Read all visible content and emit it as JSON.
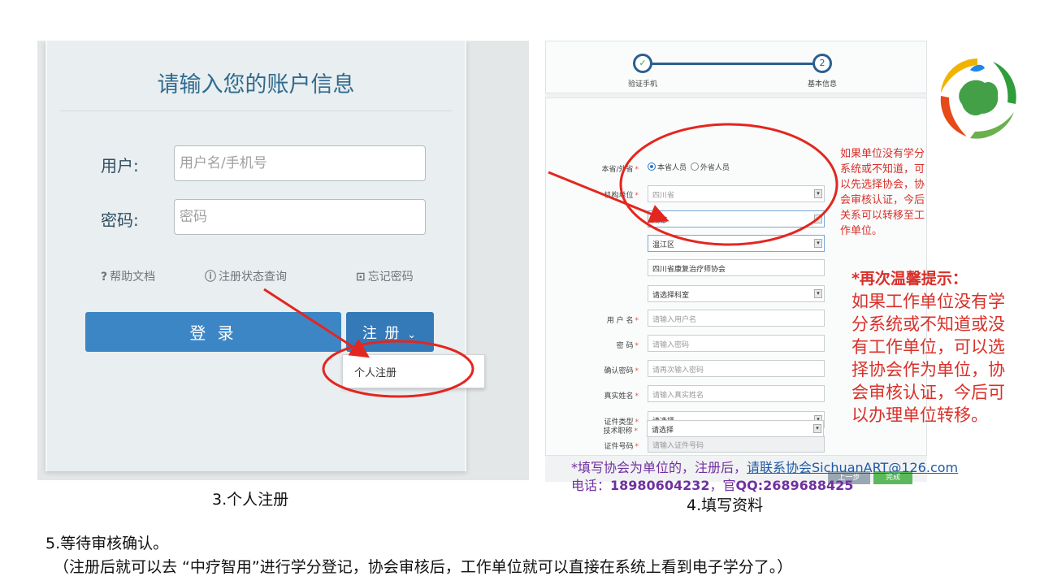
{
  "login": {
    "title": "请输入您的账户信息",
    "user_label": "用户:",
    "user_placeholder": "用户名/手机号",
    "pwd_label": "密码:",
    "pwd_placeholder": "密码",
    "help_doc": "帮助文档",
    "status_query": "注册状态查询",
    "forgot": "忘记密码",
    "login_button": "登 录",
    "register_button": "注 册",
    "menu_item": "个人注册"
  },
  "caption_left": "3.个人注册",
  "caption_right": "4.填写资料",
  "form": {
    "step1": "验证手机",
    "step2": "基本信息",
    "step2_number": "2",
    "province_label": "本省/外省",
    "radio_local": "本省人员",
    "radio_other": "外省人员",
    "org_label": "机构单位",
    "org_province": "四川省",
    "org_city": "成都",
    "org_district": "温江区",
    "org_name": "四川省康复治疗师协会",
    "org_dept": "请选择科室",
    "username_label": "用 户 名",
    "username_ph": "请输入用户名",
    "password_label": "密 码",
    "password_ph": "请输入密码",
    "confirm_label": "确认密码",
    "confirm_ph": "请再次输入密码",
    "realname_label": "真实姓名",
    "realname_ph": "请输入真实姓名",
    "idtype_label": "证件类型",
    "idtype_ph": "请选择",
    "idno_label": "证件号码",
    "idno_ph": "请输入证件号码",
    "title_label": "技术职称",
    "title_ph": "请选择",
    "prev_btn": "上一步",
    "finish_btn": "完成"
  },
  "red_note": "如果单位没有学分系统或不知道，可以先选择协会，协会审核认证，今后关系可以转移至工作单位。",
  "tip_title": "*再次温馨提示：",
  "tip_body": "如果工作单位没有学分系统或不知道或没有工作单位，可以选择协会作为单位，协会审核认证，今后可以办理单位转移。",
  "contact": {
    "line1_prefix": "*填写协会为单位的，注册后，",
    "line1_link": "请联系协会SichuanART@126.com",
    "line2_prefix": "电话：",
    "phone": "18980604232",
    "qq_prefix": "，官",
    "qq": "QQ:2689688425"
  },
  "step5": "5.等待审核确认。",
  "step5_note": "（注册后就可以去 “中疗智用”进行学分登记，协会审核后，工作单位就可以直接在系统上看到电子学分了。）",
  "colors": {
    "accent_blue": "#3d86c6",
    "annotation_red": "#e3261f",
    "contact_purple": "#7030a0"
  }
}
